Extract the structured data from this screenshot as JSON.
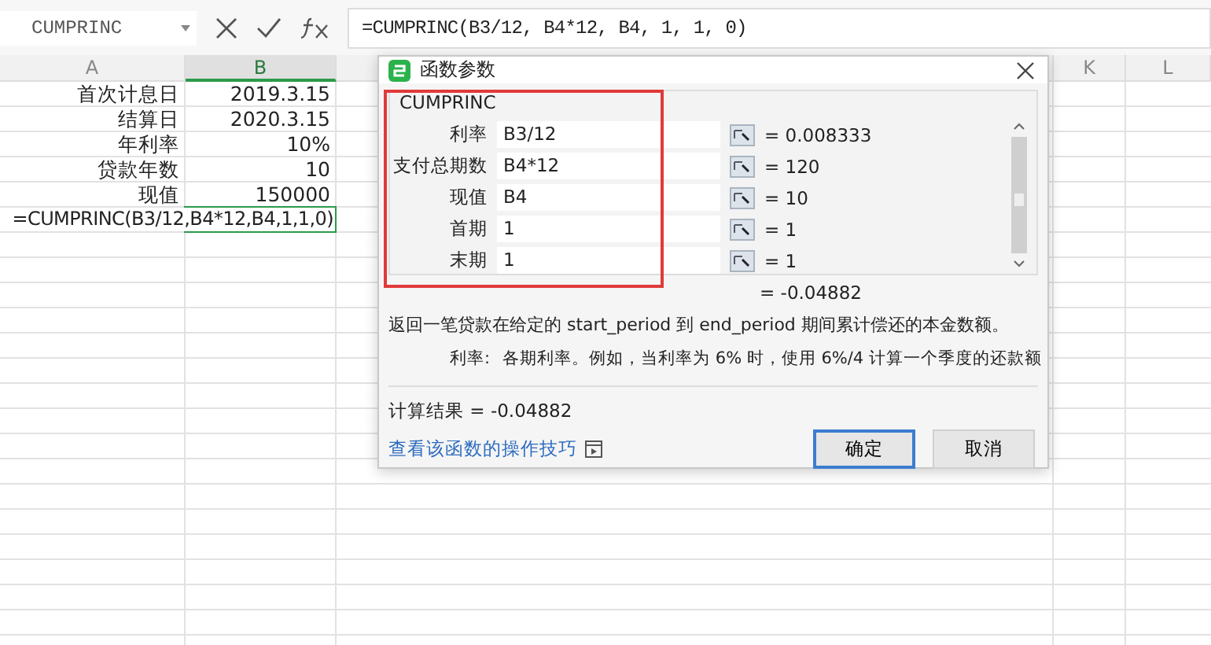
{
  "name_box": {
    "value": "CUMPRINC"
  },
  "formula_bar": {
    "value": "=CUMPRINC(B3/12, B4*12, B4, 1, 1, 0)"
  },
  "columns": [
    {
      "label": "A",
      "selected": false
    },
    {
      "label": "B",
      "selected": true
    },
    {
      "label": "K",
      "selected": false
    },
    {
      "label": "L",
      "selected": false
    }
  ],
  "rows": [
    {
      "kind": "data",
      "label": "首次计息日",
      "value": "2019.3.15",
      "selected": false
    },
    {
      "kind": "data",
      "label": "结算日",
      "value": "2020.3.15",
      "selected": false
    },
    {
      "kind": "data",
      "label": "年利率",
      "value": "10%",
      "selected": false
    },
    {
      "kind": "data",
      "label": "贷款年数",
      "value": "10",
      "selected": false
    },
    {
      "kind": "data",
      "label": "现值",
      "value": "150000",
      "selected": false
    },
    {
      "kind": "formula",
      "text": "=CUMPRINC(B3/12,B4*12,B4,1,1,0)",
      "selected": true
    }
  ],
  "dialog": {
    "title": "函数参数",
    "function_name": "CUMPRINC",
    "arguments": [
      {
        "label": "利率",
        "value": "B3/12",
        "result": "= 0.008333"
      },
      {
        "label": "支付总期数",
        "value": "B4*12",
        "result": "= 120"
      },
      {
        "label": "现值",
        "value": "B4",
        "result": "= 10"
      },
      {
        "label": "首期",
        "value": "1",
        "result": "= 1"
      },
      {
        "label": "末期",
        "value": "1",
        "result": "= 1"
      }
    ],
    "formula_result": "= -0.04882",
    "description": "返回一笔贷款在给定的 start_period 到 end_period 期间累计偿还的本金数额。",
    "argument_help_label": "利率:",
    "argument_help": "各期利率。例如，当利率为 6% 时，使用 6%/4 计算一个季度的还款额",
    "calculation_result": "计算结果 = -0.04882",
    "help_link": "查看该函数的操作技巧",
    "buttons": [
      {
        "label": "确定",
        "kind": "primary"
      },
      {
        "label": "取消",
        "kind": "normal"
      }
    ]
  }
}
